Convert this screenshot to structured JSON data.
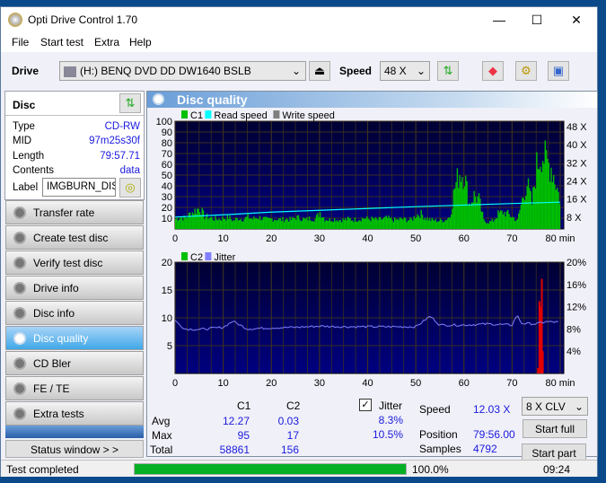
{
  "window": {
    "title": "Opti Drive Control 1.70",
    "minimize": "—",
    "maximize": "☐",
    "close": "✕"
  },
  "menu": [
    "File",
    "Start test",
    "Extra",
    "Help"
  ],
  "toolbar": {
    "drive_label": "Drive",
    "drive_value": "(H:)   BENQ DVD DD DW1640 BSLB",
    "speed_label": "Speed",
    "speed_value": "48 X"
  },
  "disc": {
    "title": "Disc",
    "type_label": "Type",
    "type": "CD-RW",
    "mid_label": "MID",
    "mid": "97m25s30f",
    "length_label": "Length",
    "length": "79:57.71",
    "contents_label": "Contents",
    "contents": "data",
    "label_label": "Label",
    "label": "IMGBURN_DIS"
  },
  "nav": [
    {
      "label": "Transfer rate"
    },
    {
      "label": "Create test disc"
    },
    {
      "label": "Verify test disc"
    },
    {
      "label": "Drive info"
    },
    {
      "label": "Disc info"
    },
    {
      "label": "Disc quality",
      "active": true
    },
    {
      "label": "CD Bler"
    },
    {
      "label": "FE / TE"
    },
    {
      "label": "Extra tests"
    }
  ],
  "status_window_label": "Status window > >",
  "main": {
    "title": "Disc quality"
  },
  "colors": {
    "c1": "#00c000",
    "read_speed": "#00ffff",
    "write_speed": "#808080",
    "c2": "#e00000",
    "jitter": "#8080ff",
    "plot_bg_top": "#000033",
    "plot_bg_bottom": "#000080"
  },
  "chart_data": [
    {
      "type": "bar",
      "legend": [
        "C1",
        "Read speed",
        "Write speed"
      ],
      "xlim": [
        0,
        80
      ],
      "xunit": "min",
      "ylim": [
        0,
        100
      ],
      "xticks": [
        0,
        10,
        20,
        30,
        40,
        50,
        60,
        70,
        80
      ],
      "yticks": [
        10,
        20,
        30,
        40,
        50,
        60,
        70,
        80,
        90,
        100
      ],
      "y2ticks": [
        "8 X",
        "16 X",
        "24 X",
        "32 X",
        "40 X",
        "48 X"
      ],
      "y2values": [
        8,
        16,
        24,
        32,
        40,
        48
      ],
      "c1_by_minute": [
        12,
        14,
        13,
        18,
        22,
        25,
        15,
        14,
        12,
        12,
        13,
        14,
        10,
        13,
        12,
        14,
        12,
        14,
        13,
        11,
        12,
        12,
        11,
        12,
        11,
        14,
        13,
        11,
        13,
        12,
        20,
        12,
        11,
        12,
        11,
        11,
        12,
        11,
        12,
        13,
        12,
        12,
        11,
        12,
        13,
        11,
        11,
        12,
        11,
        11,
        17,
        18,
        13,
        11,
        10,
        10,
        11,
        15,
        50,
        68,
        65,
        30,
        40,
        35,
        10,
        8,
        10,
        18,
        20,
        18,
        14,
        10,
        35,
        55,
        30,
        75,
        92,
        80,
        75,
        55,
        30
      ],
      "read_speed": {
        "x": [
          0,
          10,
          20,
          30,
          40,
          50,
          60,
          70,
          80
        ],
        "y": [
          8,
          9,
          10.2,
          11,
          11.8,
          12.6,
          13.3,
          14,
          14.6
        ]
      }
    },
    {
      "type": "bar",
      "legend": [
        "C2",
        "Jitter"
      ],
      "xlim": [
        0,
        80
      ],
      "xunit": "min",
      "ylim": [
        0,
        20
      ],
      "xticks": [
        0,
        10,
        20,
        30,
        40,
        50,
        60,
        70,
        80
      ],
      "yticks": [
        5,
        10,
        15,
        20
      ],
      "y2ticks": [
        "4%",
        "8%",
        "12%",
        "16%",
        "20%"
      ],
      "y2values": [
        4,
        8,
        12,
        16,
        20
      ],
      "c2": {
        "x": [
          75.2,
          75.5,
          75.8,
          76.0,
          76.2
        ],
        "y": [
          1,
          13,
          12,
          17,
          4
        ]
      },
      "jitter": {
        "x": [
          0,
          2,
          5,
          10,
          12,
          15,
          20,
          25,
          30,
          35,
          40,
          45,
          50,
          53,
          55,
          60,
          65,
          70,
          71,
          72,
          75,
          77,
          80
        ],
        "y": [
          9.5,
          8.0,
          7.9,
          8.3,
          9.4,
          8.0,
          8.2,
          8.3,
          8.5,
          8.4,
          8.4,
          8.4,
          8.4,
          10.3,
          8.7,
          8.7,
          8.9,
          8.7,
          10.5,
          9.0,
          8.9,
          9.3,
          9.2
        ]
      }
    }
  ],
  "stats": {
    "c1_header": "C1",
    "c2_header": "C2",
    "avg_label": "Avg",
    "max_label": "Max",
    "total_label": "Total",
    "c1_avg": "12.27",
    "c2_avg": "0.03",
    "c1_max": "95",
    "c2_max": "17",
    "c1_total": "58861",
    "c2_total": "156",
    "jitter_label": "Jitter",
    "jitter_checked": true,
    "jitter_avg": "8.3%",
    "jitter_max": "10.5%",
    "speed_label": "Speed",
    "speed": "12.03 X",
    "position_label": "Position",
    "position": "79:56.00",
    "samples_label": "Samples",
    "samples": "4792",
    "mode": "8 X CLV",
    "start_full": "Start full",
    "start_part": "Start part"
  },
  "statusbar": {
    "text": "Test completed",
    "progress_pct": 100,
    "progress_text": "100.0%",
    "time": "09:24"
  }
}
